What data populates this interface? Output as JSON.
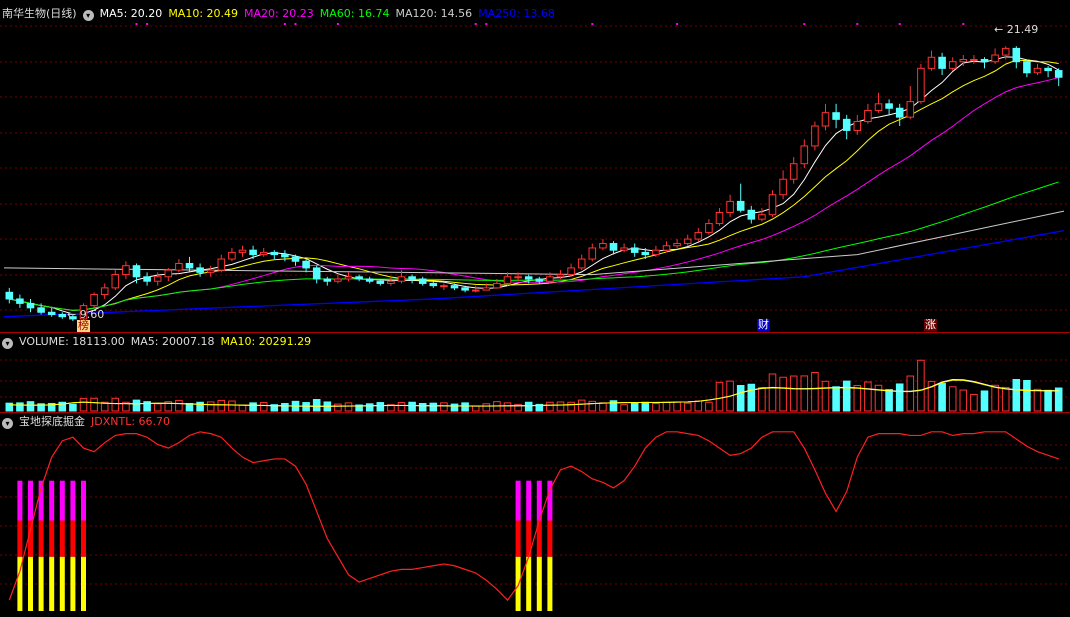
{
  "panels": {
    "main": {
      "stock_name": "南华生物(日线)",
      "indicators": [
        {
          "label": "MA5: 20.20",
          "color": "#ffffff"
        },
        {
          "label": "MA10: 20.49",
          "color": "#ffff00"
        },
        {
          "label": "MA20: 20.23",
          "color": "#ff00ff"
        },
        {
          "label": "MA60: 16.74",
          "color": "#00ff00"
        },
        {
          "label": "MA120: 14.56",
          "color": "#cccccc"
        },
        {
          "label": "MA250: 13.68",
          "color": "#0000ff"
        }
      ],
      "high_label": "21.49",
      "low_label": "9.60",
      "event_markers": [
        "榜",
        "财",
        "涨"
      ]
    },
    "volume": {
      "title": "VOLUME: 18113.00",
      "ma5": "MA5: 20007.18",
      "ma10": "MA10: 20291.29"
    },
    "indicator": {
      "name": "宝地探底掘金",
      "value": "JDXNTL: 66.70"
    }
  },
  "colors": {
    "up": "#ff3232",
    "down": "#54ffff",
    "grid": "#7a0000",
    "separator": "#aa0000"
  },
  "chart_data": {
    "type": "candlestick",
    "price_range": [
      9.2,
      23.0
    ],
    "candles": [
      [
        10.9,
        10.6,
        11.1,
        10.4
      ],
      [
        10.6,
        10.4,
        10.8,
        10.2
      ],
      [
        10.4,
        10.2,
        10.6,
        10.0
      ],
      [
        10.2,
        10.0,
        10.4,
        9.9
      ],
      [
        10.0,
        9.9,
        10.2,
        9.8
      ],
      [
        9.9,
        9.8,
        10.0,
        9.7
      ],
      [
        9.8,
        9.7,
        9.9,
        9.6
      ],
      [
        9.7,
        10.3,
        10.4,
        9.6
      ],
      [
        10.3,
        10.8,
        10.9,
        10.2
      ],
      [
        10.8,
        11.1,
        11.3,
        10.6
      ],
      [
        11.1,
        11.7,
        11.9,
        11.0
      ],
      [
        11.7,
        12.1,
        12.3,
        11.5
      ],
      [
        12.1,
        11.6,
        12.2,
        11.3
      ],
      [
        11.6,
        11.4,
        11.8,
        11.2
      ],
      [
        11.4,
        11.6,
        11.8,
        11.2
      ],
      [
        11.6,
        11.9,
        12.0,
        11.4
      ],
      [
        11.9,
        12.2,
        12.4,
        11.8
      ],
      [
        12.2,
        12.0,
        12.5,
        11.8
      ],
      [
        12.0,
        11.8,
        12.2,
        11.6
      ],
      [
        11.8,
        11.9,
        12.1,
        11.6
      ],
      [
        11.9,
        12.4,
        12.6,
        11.8
      ],
      [
        12.4,
        12.7,
        12.9,
        12.3
      ],
      [
        12.7,
        12.8,
        13.0,
        12.5
      ],
      [
        12.8,
        12.6,
        13.0,
        12.4
      ],
      [
        12.6,
        12.7,
        12.9,
        12.5
      ],
      [
        12.7,
        12.6,
        12.8,
        12.4
      ],
      [
        12.6,
        12.5,
        12.8,
        12.3
      ],
      [
        12.5,
        12.3,
        12.6,
        12.1
      ],
      [
        12.3,
        12.0,
        12.4,
        11.8
      ],
      [
        12.0,
        11.5,
        12.1,
        11.3
      ],
      [
        11.5,
        11.4,
        11.6,
        11.2
      ],
      [
        11.4,
        11.5,
        11.7,
        11.3
      ],
      [
        11.5,
        11.6,
        11.8,
        11.4
      ],
      [
        11.6,
        11.5,
        11.7,
        11.4
      ],
      [
        11.5,
        11.4,
        11.6,
        11.3
      ],
      [
        11.4,
        11.3,
        11.5,
        11.2
      ],
      [
        11.3,
        11.4,
        11.6,
        11.2
      ],
      [
        11.4,
        11.6,
        11.9,
        11.3
      ],
      [
        11.6,
        11.5,
        11.7,
        11.3
      ],
      [
        11.5,
        11.3,
        11.6,
        11.2
      ],
      [
        11.3,
        11.2,
        11.4,
        11.1
      ],
      [
        11.2,
        11.2,
        11.3,
        11.0
      ],
      [
        11.2,
        11.1,
        11.3,
        11.0
      ],
      [
        11.1,
        11.0,
        11.2,
        10.9
      ],
      [
        11.0,
        11.0,
        11.2,
        10.9
      ],
      [
        11.0,
        11.1,
        11.3,
        11.0
      ],
      [
        11.1,
        11.3,
        11.5,
        11.1
      ],
      [
        11.3,
        11.6,
        11.8,
        11.2
      ],
      [
        11.6,
        11.6,
        11.8,
        11.4
      ],
      [
        11.6,
        11.5,
        11.7,
        11.3
      ],
      [
        11.5,
        11.4,
        11.6,
        11.3
      ],
      [
        11.4,
        11.6,
        11.8,
        11.3
      ],
      [
        11.6,
        11.7,
        11.9,
        11.5
      ],
      [
        11.7,
        12.0,
        12.2,
        11.6
      ],
      [
        12.0,
        12.4,
        12.6,
        11.9
      ],
      [
        12.4,
        12.9,
        13.1,
        12.3
      ],
      [
        12.9,
        13.1,
        13.3,
        12.8
      ],
      [
        13.1,
        12.8,
        13.2,
        12.6
      ],
      [
        12.8,
        12.9,
        13.1,
        12.7
      ],
      [
        12.9,
        12.7,
        13.1,
        12.5
      ],
      [
        12.7,
        12.6,
        12.9,
        12.4
      ],
      [
        12.6,
        12.8,
        13.0,
        12.5
      ],
      [
        12.8,
        13.0,
        13.2,
        12.7
      ],
      [
        13.0,
        13.1,
        13.3,
        12.9
      ],
      [
        13.1,
        13.3,
        13.5,
        13.0
      ],
      [
        13.3,
        13.6,
        13.8,
        13.2
      ],
      [
        13.6,
        14.0,
        14.2,
        13.5
      ],
      [
        14.0,
        14.5,
        14.7,
        13.9
      ],
      [
        14.5,
        15.0,
        15.3,
        14.3
      ],
      [
        15.0,
        14.6,
        15.8,
        14.5
      ],
      [
        14.6,
        14.2,
        14.8,
        14.0
      ],
      [
        14.2,
        14.4,
        14.7,
        14.1
      ],
      [
        14.4,
        15.3,
        15.5,
        14.3
      ],
      [
        15.3,
        16.0,
        16.4,
        15.1
      ],
      [
        16.0,
        16.7,
        17.0,
        15.8
      ],
      [
        16.7,
        17.5,
        17.8,
        16.5
      ],
      [
        17.5,
        18.4,
        18.6,
        17.3
      ],
      [
        18.4,
        19.0,
        19.4,
        18.2
      ],
      [
        19.0,
        18.7,
        19.4,
        18.3
      ],
      [
        18.7,
        18.2,
        18.9,
        17.8
      ],
      [
        18.2,
        18.6,
        18.9,
        18.0
      ],
      [
        18.6,
        19.1,
        19.4,
        18.5
      ],
      [
        19.1,
        19.4,
        19.9,
        19.0
      ],
      [
        19.4,
        19.2,
        19.6,
        18.9
      ],
      [
        19.2,
        18.8,
        19.4,
        18.4
      ],
      [
        18.8,
        19.5,
        20.2,
        18.7
      ],
      [
        19.5,
        21.0,
        21.2,
        19.4
      ],
      [
        21.0,
        21.5,
        21.8,
        20.9
      ],
      [
        21.5,
        21.0,
        21.7,
        20.7
      ],
      [
        21.0,
        21.3,
        21.5,
        20.9
      ],
      [
        21.3,
        21.4,
        21.6,
        21.1
      ],
      [
        21.4,
        21.4,
        21.6,
        21.2
      ],
      [
        21.4,
        21.3,
        21.5,
        21.0
      ],
      [
        21.3,
        21.6,
        21.9,
        21.2
      ],
      [
        21.6,
        21.9,
        22.0,
        21.4
      ],
      [
        21.9,
        21.3,
        22.0,
        21.0
      ],
      [
        21.3,
        20.8,
        21.4,
        20.6
      ],
      [
        20.8,
        21.0,
        21.2,
        20.7
      ],
      [
        21.0,
        20.9,
        21.1,
        20.6
      ],
      [
        20.9,
        20.6,
        21.0,
        20.2
      ]
    ],
    "volume": {
      "range": [
        0,
        60000
      ],
      "ma5_line": [
        6000,
        5800,
        5700,
        5600,
        6000,
        6800,
        8000,
        8700,
        8200,
        7600,
        7300,
        7200,
        7100,
        7400,
        7600,
        7500,
        7300,
        6900,
        6500,
        6200,
        6000,
        5900,
        5700,
        5500,
        5400,
        5200,
        5000,
        4800,
        4700,
        4600,
        4600,
        4700,
        4800,
        4900,
        5100,
        5300,
        5400,
        5400,
        5300,
        5200,
        5100,
        5000,
        4900,
        4900,
        4800,
        4800,
        4900,
        5000,
        5100,
        5200,
        5400,
        5600,
        5800,
        6100,
        6600,
        7200,
        7700,
        8000,
        8200,
        8300,
        8300,
        8400,
        8500,
        8700,
        9000,
        9600,
        10800,
        12500,
        14600,
        18000,
        20700,
        22500,
        23200,
        22700,
        22100,
        22000,
        22300,
        22700,
        23100,
        23200,
        22800,
        21900,
        20900,
        20000,
        19400,
        19400,
        20600,
        24000,
        28500,
        31000,
        30800,
        29000,
        26300,
        23600,
        22000,
        21000,
        20400,
        20200,
        20000,
        20000
      ]
    },
    "jdxntl": {
      "range": [
        0,
        100
      ],
      "values": [
        6,
        22,
        45,
        68,
        85,
        94,
        96,
        90,
        88,
        93,
        97,
        98,
        98,
        96,
        92,
        90,
        93,
        97,
        99,
        98,
        96,
        90,
        85,
        82,
        83,
        84,
        84,
        80,
        70,
        55,
        40,
        30,
        20,
        16,
        18,
        20,
        22,
        23,
        23,
        24,
        25,
        26,
        25,
        23,
        21,
        17,
        12,
        6,
        14,
        30,
        50,
        67,
        78,
        80,
        77,
        73,
        71,
        68,
        72,
        80,
        90,
        96,
        99,
        99,
        98,
        97,
        94,
        90,
        86,
        87,
        90,
        96,
        99,
        99,
        99,
        90,
        78,
        65,
        55,
        66,
        85,
        96,
        98,
        98,
        98,
        97,
        97,
        99,
        99,
        97,
        98,
        98,
        99,
        99,
        99,
        95,
        91,
        88,
        86,
        84
      ],
      "signal_days": [
        1,
        2,
        3,
        4,
        5,
        6,
        7,
        48,
        49,
        50,
        51
      ]
    }
  }
}
